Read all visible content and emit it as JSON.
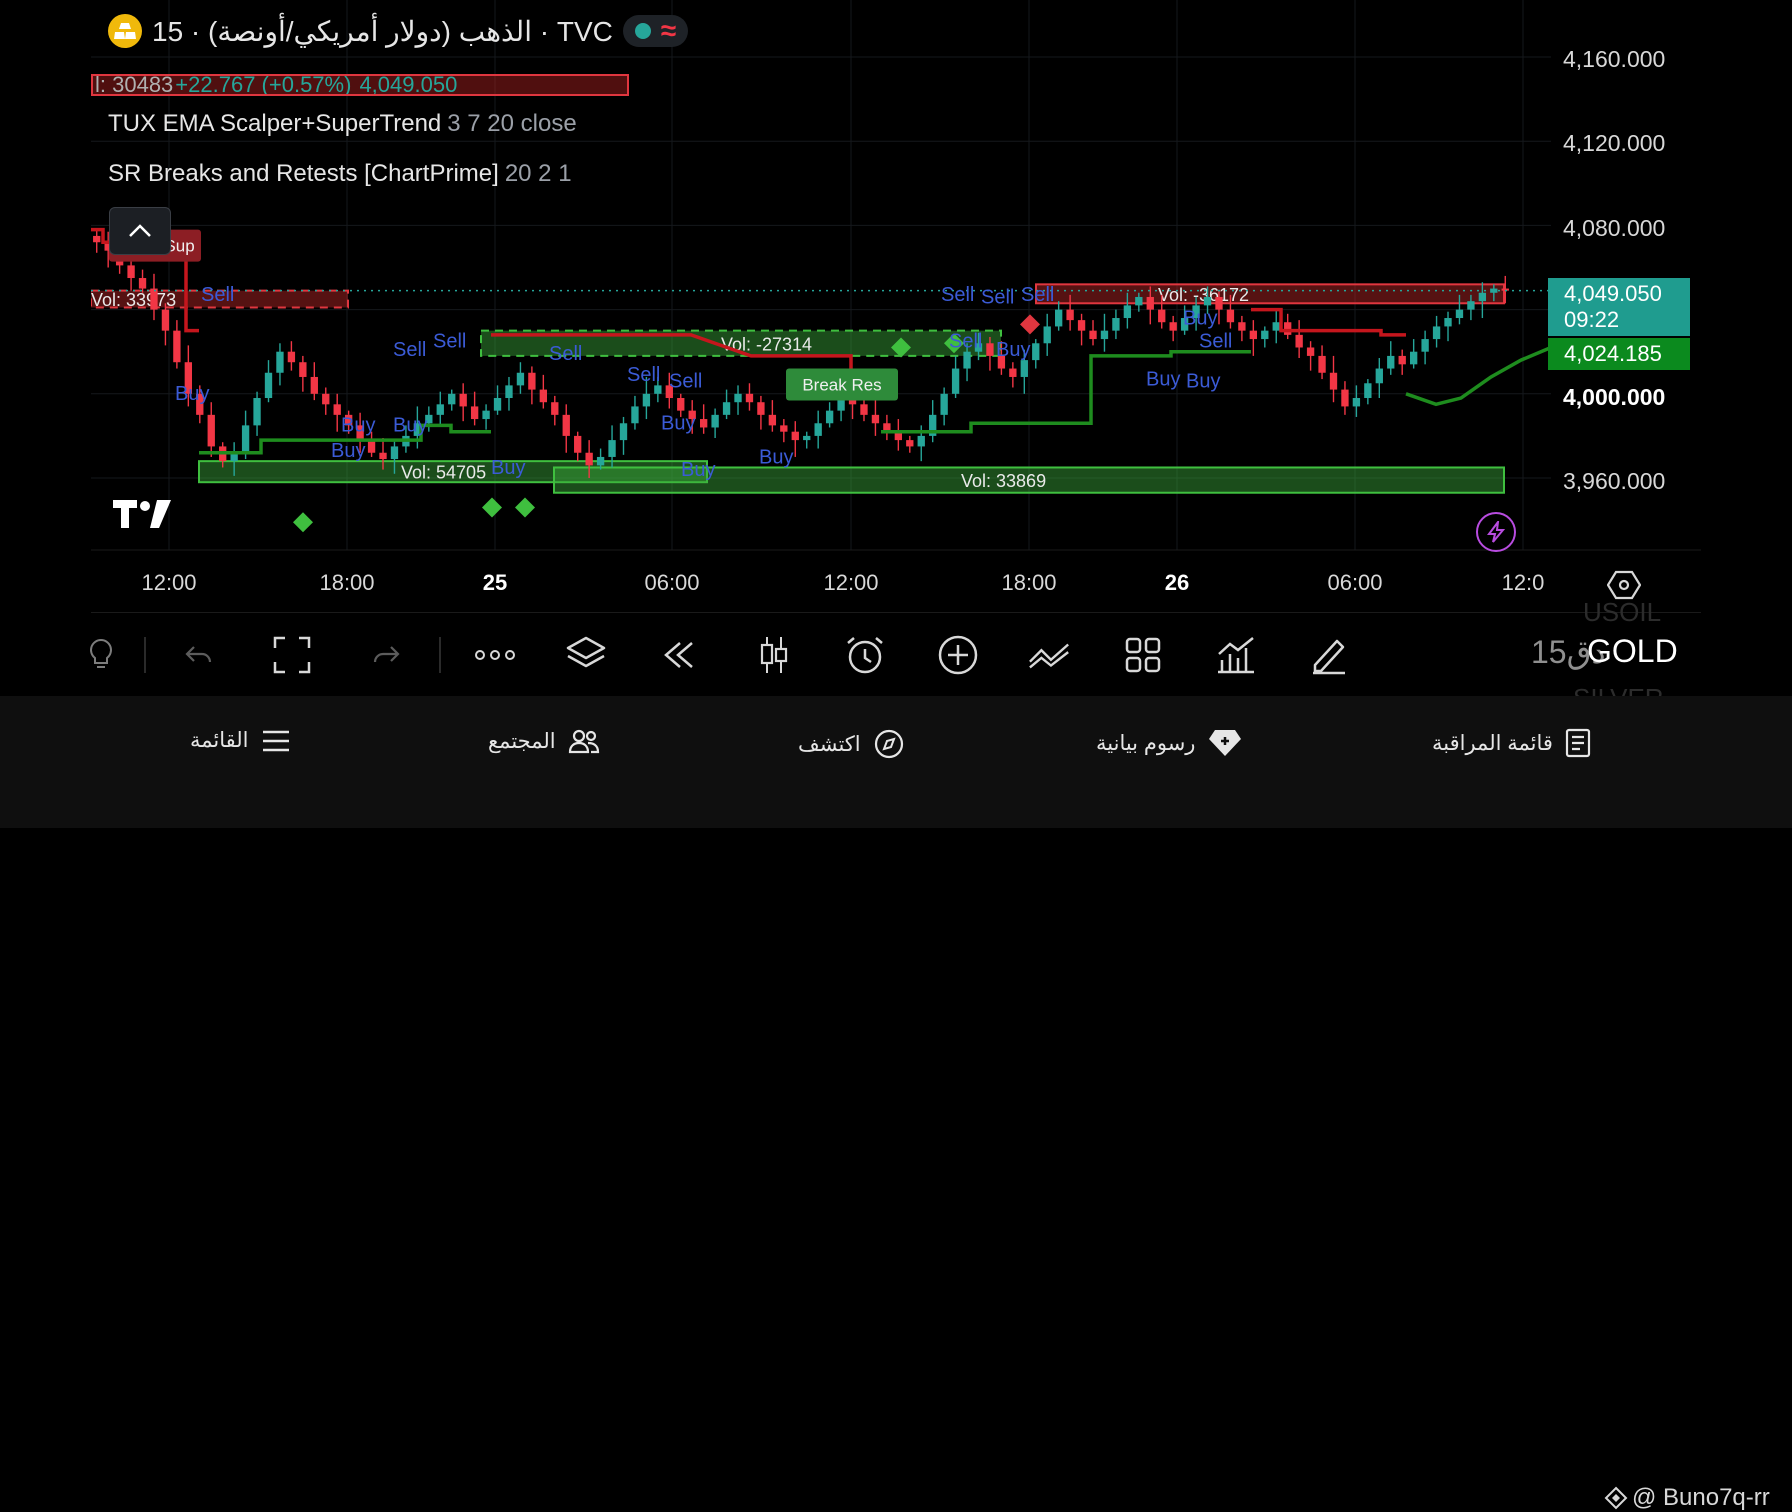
{
  "header": {
    "title": "الذهب (دولار أمريكي/أونصة) · 15 · TVC",
    "market_status": "open",
    "quote_vol": "l: 30483",
    "change": "+22.767 (+0.57%)",
    "last_price": "4,049.050"
  },
  "indicators": [
    {
      "name": "TUX EMA Scalper+SuperTrend",
      "params": "3 7 20 close"
    },
    {
      "name": "SR Breaks and Retests [ChartPrime]",
      "params": "20 2 1"
    }
  ],
  "price_axis": {
    "labels": [
      "4,160.000",
      "4,120.000",
      "4,080.000",
      "4,000.000",
      "3,960.000"
    ],
    "current_price": "4,049.050",
    "countdown": "09:22",
    "supertrend_value": "4,024.185"
  },
  "time_axis": {
    "labels": [
      "12:00",
      "18:00",
      "25",
      "06:00",
      "12:00",
      "18:00",
      "26",
      "06:00",
      "12:0"
    ]
  },
  "chart_data": {
    "type": "candlestick",
    "y_range": [
      3930,
      4170
    ],
    "series": [
      {
        "name": "",
        "values": [
          4072,
          4068,
          4061,
          4055,
          4050,
          4040,
          4030,
          4015,
          4000,
          3990,
          3975,
          3968,
          3972,
          3985,
          3998,
          4010,
          4020,
          4015,
          4008,
          4000,
          3995,
          3990,
          3985,
          3978,
          3972,
          3969,
          3975,
          3980,
          3986,
          3990,
          3995,
          4000,
          3994,
          3988,
          3992,
          3998,
          4004,
          4010,
          4002,
          3996,
          3990,
          3980,
          3972,
          3966,
          3970,
          3978,
          3986,
          3994,
          4000,
          4004,
          3998,
          3992,
          3988,
          3984,
          3990,
          3996,
          4000,
          3996,
          3990,
          3985,
          3982,
          3978,
          3980,
          3986,
          3992,
          3998,
          3995,
          3990,
          3986,
          3982,
          3978,
          3975,
          3980,
          3990,
          4000,
          4012,
          4020,
          4024,
          4018,
          4012,
          4008,
          4016,
          4024,
          4032,
          4040,
          4035,
          4030,
          4026,
          4030,
          4036,
          4042,
          4046,
          4040,
          4034,
          4030,
          4036,
          4042,
          4046,
          4040,
          4034,
          4030,
          4026,
          4030,
          4034,
          4028,
          4022,
          4018,
          4010,
          4002,
          3994,
          3998,
          4005,
          4012,
          4018,
          4014,
          4020,
          4026,
          4032,
          4036,
          4040,
          4044,
          4048,
          4050,
          4049
        ]
      }
    ],
    "zones": [
      {
        "label": "Vol: 33973",
        "kind": "resistance"
      },
      {
        "label": "Vol: 54705",
        "kind": "support"
      },
      {
        "label": "Vol: -27314",
        "kind": "support-dashed"
      },
      {
        "label": "Vol: 33869",
        "kind": "support"
      },
      {
        "label": "Vol: -36172",
        "kind": "resistance"
      }
    ],
    "annotations": [
      {
        "label": "Break Sup",
        "kind": "break-down"
      },
      {
        "label": "Break Res",
        "kind": "break-up"
      }
    ],
    "signal_labels": [
      "Sell",
      "Buy",
      "Buy",
      "Buy",
      "Sell",
      "Sell",
      "Buy",
      "Buy",
      "Sell",
      "Buy",
      "Sell",
      "Sell",
      "Buy",
      "Buy",
      "Sell",
      "Sell",
      "Sell",
      "Sell",
      "Buy",
      "Buy",
      "Buy",
      "Buy",
      "Sell"
    ]
  },
  "toolbar": {
    "interval": "15دق",
    "symbol": "GOLD",
    "ghost_above": "USOIL",
    "ghost_below": "SILVER"
  },
  "bottom_nav": [
    {
      "label": "القائمة",
      "icon": "menu-icon"
    },
    {
      "label": "المجتمع",
      "icon": "community-icon"
    },
    {
      "label": "اكتشف",
      "icon": "compass-icon"
    },
    {
      "label": "رسوم بيانية",
      "icon": "chart-diamond-icon"
    },
    {
      "label": "قائمة المراقبة",
      "icon": "watchlist-icon"
    }
  ],
  "watermark": "@ Buno7q-rr",
  "colors": {
    "up": "#26a69a",
    "down": "#f23645",
    "resistance": "#e0363f",
    "support": "#3fbf3f",
    "supertrend_up": "#1e8c1e",
    "supertrend_down": "#c5161d",
    "signal_text": "#3b5bd6"
  }
}
